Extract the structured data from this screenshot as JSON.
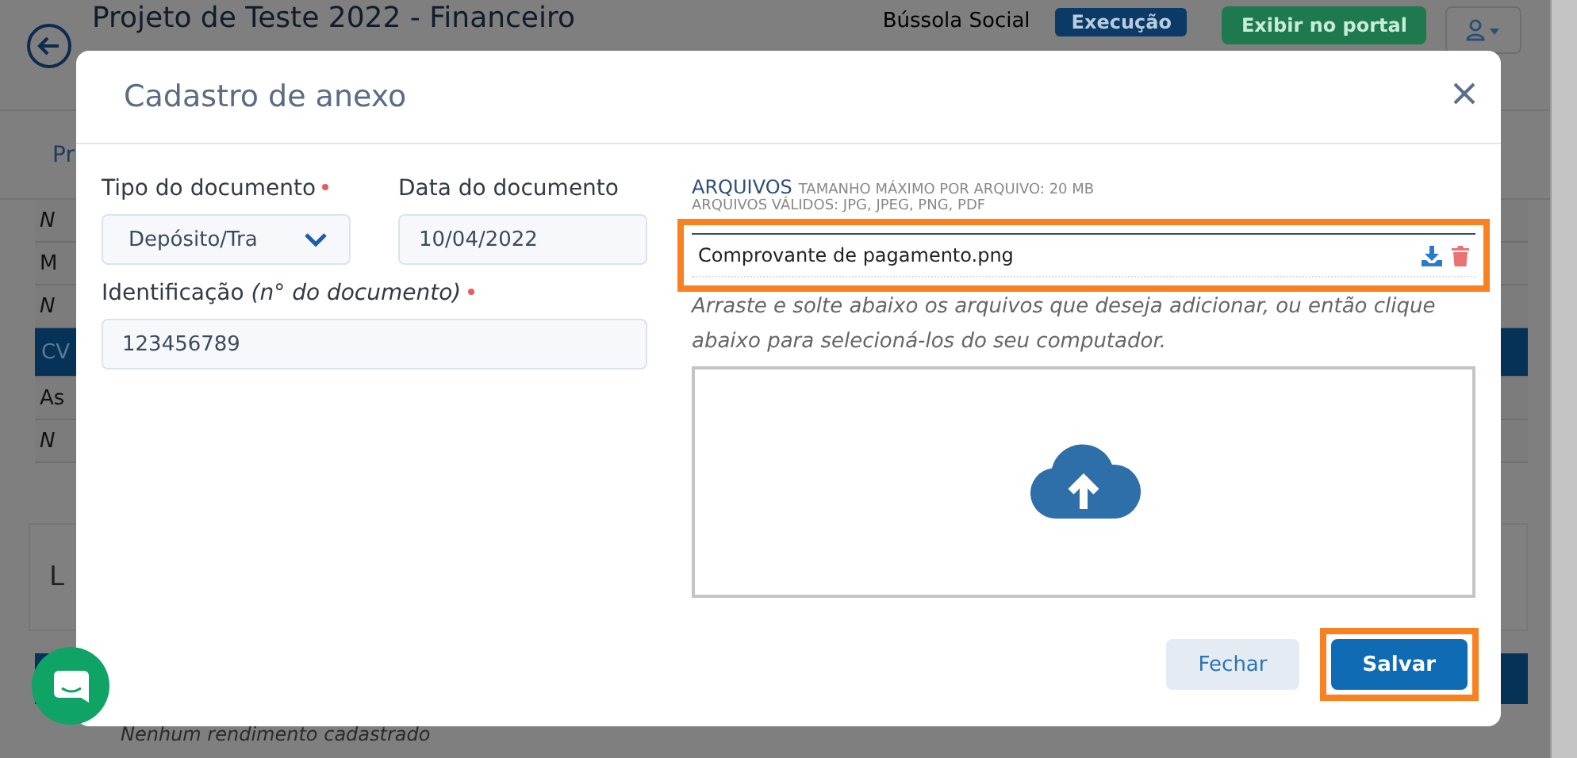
{
  "page": {
    "title": "Projeto de Teste 2022 - Financeiro",
    "project": "Bússola Social",
    "status_badge": "Execução",
    "portal_button": "Exibir no portal",
    "tab": "Pr",
    "rows": [
      {
        "text": "N",
        "kind": "note",
        "selected": false
      },
      {
        "text": "M",
        "kind": "item",
        "selected": false
      },
      {
        "text": "N",
        "kind": "note",
        "selected": false
      },
      {
        "text": "CV",
        "kind": "item",
        "selected": true
      },
      {
        "text": "As",
        "kind": "item",
        "selected": false
      },
      {
        "text": "N",
        "kind": "note",
        "selected": false
      }
    ],
    "section_title": "L",
    "empty_message": "Nenhum rendimento cadastrado"
  },
  "modal": {
    "title": "Cadastro de anexo",
    "doc_type": {
      "label": "Tipo do documento",
      "required": true,
      "value": "Depósito/Tra"
    },
    "doc_date": {
      "label": "Data do documento",
      "required": false,
      "value": "10/04/2022"
    },
    "identification": {
      "label": "Identificação *(n° do documento)*",
      "required": true,
      "value": "123456789"
    },
    "files": {
      "heading": "ARQUIVOS",
      "max_size": "TAMANHO MÁXIMO POR ARQUIVO: 20 MB",
      "valid_types": "ARQUIVOS VÁLIDOS: JPG, JPEG, PNG, PDF",
      "highlighted": true,
      "items": [
        {
          "name": "Comprovante de pagamento.png"
        }
      ],
      "hint": "Arraste e solte abaixo os arquivos que deseja adicionar, ou então clique abaixo para selecioná-los do seu computador."
    },
    "buttons": [
      {
        "label": "Fechar",
        "kind": "secondary",
        "highlighted": false
      },
      {
        "label": "Salvar",
        "kind": "primary",
        "highlighted": true
      }
    ]
  }
}
